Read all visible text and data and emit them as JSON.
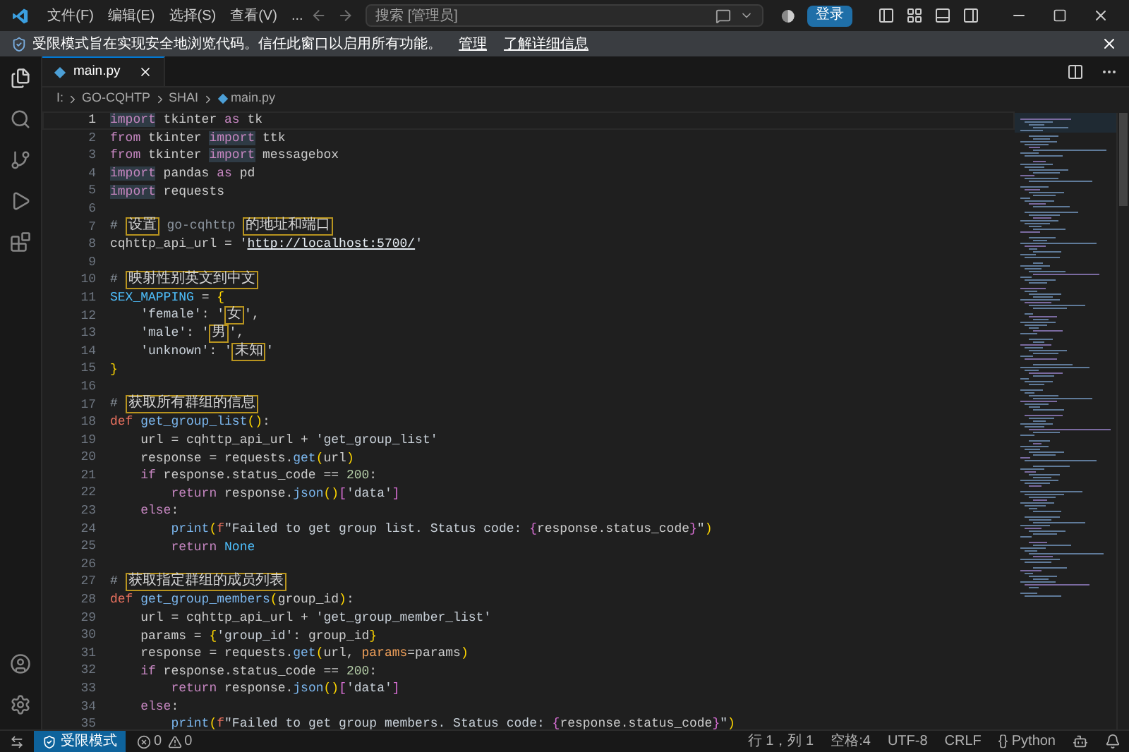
{
  "menu": [
    "文件(F)",
    "编辑(E)",
    "选择(S)",
    "查看(V)",
    "..."
  ],
  "search": {
    "placeholder": "搜索 [管理员]"
  },
  "login_button": "登录",
  "notice": {
    "text": "受限模式旨在实现安全地浏览代码。信任此窗口以启用所有功能。",
    "links": [
      "管理",
      "了解详细信息"
    ]
  },
  "tabs": [
    {
      "label": "main.py",
      "selected": true
    }
  ],
  "breadcrumb": [
    "I:",
    "GO-CQHTP",
    "SHAI",
    "main.py"
  ],
  "code": {
    "lines": [
      {
        "number": "1",
        "current": true,
        "tokens": [
          {
            "text": "import",
            "kind": "kw",
            "highlighted": true
          },
          {
            "text": " tkinter ",
            "kind": "plain"
          },
          {
            "text": "as",
            "kind": "kw"
          },
          {
            "text": " tk",
            "kind": "plain"
          }
        ]
      },
      {
        "number": "2",
        "current": false,
        "tokens": [
          {
            "text": "from",
            "kind": "kw"
          },
          {
            "text": " tkinter ",
            "kind": "plain"
          },
          {
            "text": "import",
            "kind": "kw",
            "highlighted": true
          },
          {
            "text": " ttk",
            "kind": "plain"
          }
        ]
      },
      {
        "number": "3",
        "current": false,
        "tokens": [
          {
            "text": "from",
            "kind": "kw"
          },
          {
            "text": " tkinter ",
            "kind": "plain"
          },
          {
            "text": "import",
            "kind": "kw",
            "highlighted": true
          },
          {
            "text": " messagebox",
            "kind": "plain"
          }
        ]
      },
      {
        "number": "4",
        "current": false,
        "tokens": [
          {
            "text": "import",
            "kind": "kw",
            "highlighted": true
          },
          {
            "text": " pandas ",
            "kind": "plain"
          },
          {
            "text": "as",
            "kind": "kw"
          },
          {
            "text": " pd",
            "kind": "plain"
          }
        ]
      },
      {
        "number": "5",
        "current": false,
        "tokens": [
          {
            "text": "import",
            "kind": "kw",
            "highlighted": true
          },
          {
            "text": " requests",
            "kind": "plain"
          }
        ]
      },
      {
        "number": "6",
        "current": false
      },
      {
        "number": "7",
        "current": false,
        "tokens": [
          {
            "text": "# ",
            "kind": "cm"
          },
          {
            "text": "设置",
            "kind": "flag"
          },
          {
            "text": " go-cqhttp ",
            "kind": "cm"
          },
          {
            "text": "的地址和端口",
            "kind": "flag"
          }
        ]
      },
      {
        "number": "8",
        "current": false,
        "tokens": [
          {
            "text": "cqhttp_api_url = ",
            "kind": "plain"
          },
          {
            "text": "'",
            "kind": "str"
          },
          {
            "text": "http://localhost:5700/",
            "kind": "url"
          },
          {
            "text": "'",
            "kind": "str"
          }
        ]
      },
      {
        "number": "9",
        "current": false
      },
      {
        "number": "10",
        "current": false,
        "tokens": [
          {
            "text": "# ",
            "kind": "cm"
          },
          {
            "text": "映射性别英文到中文",
            "kind": "flag"
          }
        ]
      },
      {
        "number": "11",
        "current": false,
        "tokens": [
          {
            "text": "SEX_MAPPING",
            "kind": "const"
          },
          {
            "text": " = ",
            "kind": "plain"
          },
          {
            "text": "{",
            "kind": "br"
          }
        ]
      },
      {
        "number": "12",
        "current": false,
        "tokens": [
          {
            "text": "    'female'",
            "kind": "str"
          },
          {
            "text": ": ",
            "kind": "plain"
          },
          {
            "text": "'",
            "kind": "str"
          },
          {
            "text": "女",
            "kind": "flag"
          },
          {
            "text": "'",
            "kind": "str"
          },
          {
            "text": ",",
            "kind": "plain"
          }
        ]
      },
      {
        "number": "13",
        "current": false,
        "tokens": [
          {
            "text": "    'male'",
            "kind": "str"
          },
          {
            "text": ": ",
            "kind": "plain"
          },
          {
            "text": "'",
            "kind": "str"
          },
          {
            "text": "男",
            "kind": "flag"
          },
          {
            "text": "'",
            "kind": "str"
          },
          {
            "text": ",",
            "kind": "plain"
          }
        ]
      },
      {
        "number": "14",
        "current": false,
        "tokens": [
          {
            "text": "    'unknown'",
            "kind": "str"
          },
          {
            "text": ": ",
            "kind": "plain"
          },
          {
            "text": "'",
            "kind": "str"
          },
          {
            "text": "未知",
            "kind": "flag"
          },
          {
            "text": "'",
            "kind": "str"
          }
        ]
      },
      {
        "number": "15",
        "current": false,
        "tokens": [
          {
            "text": "}",
            "kind": "br"
          }
        ]
      },
      {
        "number": "16",
        "current": false
      },
      {
        "number": "17",
        "current": false,
        "tokens": [
          {
            "text": "# ",
            "kind": "cm"
          },
          {
            "text": "获取所有群组的信息",
            "kind": "flag"
          }
        ]
      },
      {
        "number": "18",
        "current": false,
        "tokens": [
          {
            "text": "def",
            "kind": "def"
          },
          {
            "text": " get_group_list",
            "kind": "fn"
          },
          {
            "text": "()",
            "kind": "br"
          },
          {
            "text": ":",
            "kind": "plain"
          }
        ]
      },
      {
        "number": "19",
        "current": false,
        "tokens": [
          {
            "text": "    url = cqhttp_api_url + ",
            "kind": "plain"
          },
          {
            "text": "'get_group_list'",
            "kind": "str"
          }
        ]
      },
      {
        "number": "20",
        "current": false,
        "tokens": [
          {
            "text": "    response = requests.",
            "kind": "plain"
          },
          {
            "text": "get",
            "kind": "fn"
          },
          {
            "text": "(",
            "kind": "br"
          },
          {
            "text": "url",
            "kind": "plain"
          },
          {
            "text": ")",
            "kind": "br"
          }
        ]
      },
      {
        "number": "21",
        "current": false,
        "tokens": [
          {
            "text": "    if",
            "kind": "kw"
          },
          {
            "text": " response.status_code == ",
            "kind": "plain"
          },
          {
            "text": "200",
            "kind": "num"
          },
          {
            "text": ":",
            "kind": "plain"
          }
        ]
      },
      {
        "number": "22",
        "current": false,
        "tokens": [
          {
            "text": "        return",
            "kind": "kw"
          },
          {
            "text": " response.",
            "kind": "plain"
          },
          {
            "text": "json",
            "kind": "fn"
          },
          {
            "text": "()",
            "kind": "br"
          },
          {
            "text": "[",
            "kind": "br2"
          },
          {
            "text": "'data'",
            "kind": "str"
          },
          {
            "text": "]",
            "kind": "br2"
          }
        ]
      },
      {
        "number": "23",
        "current": false,
        "tokens": [
          {
            "text": "    else",
            "kind": "kw"
          },
          {
            "text": ":",
            "kind": "plain"
          }
        ]
      },
      {
        "number": "24",
        "current": false,
        "tokens": [
          {
            "text": "        print",
            "kind": "fn"
          },
          {
            "text": "(",
            "kind": "br"
          },
          {
            "text": "f",
            "kind": "def"
          },
          {
            "text": "\"Failed to get group list. Status code: ",
            "kind": "str"
          },
          {
            "text": "{",
            "kind": "br2"
          },
          {
            "text": "response.status_code",
            "kind": "plain"
          },
          {
            "text": "}",
            "kind": "br2"
          },
          {
            "text": "\"",
            "kind": "str"
          },
          {
            "text": ")",
            "kind": "br"
          }
        ]
      },
      {
        "number": "25",
        "current": false,
        "tokens": [
          {
            "text": "        return",
            "kind": "kw"
          },
          {
            "text": " None",
            "kind": "const"
          }
        ]
      },
      {
        "number": "26",
        "current": false
      },
      {
        "number": "27",
        "current": false,
        "tokens": [
          {
            "text": "# ",
            "kind": "cm"
          },
          {
            "text": "获取指定群组的成员列表",
            "kind": "flag"
          }
        ]
      },
      {
        "number": "28",
        "current": false,
        "tokens": [
          {
            "text": "def",
            "kind": "def"
          },
          {
            "text": " get_group_members",
            "kind": "fn"
          },
          {
            "text": "(",
            "kind": "br"
          },
          {
            "text": "group_id",
            "kind": "plain"
          },
          {
            "text": ")",
            "kind": "br"
          },
          {
            "text": ":",
            "kind": "plain"
          }
        ]
      },
      {
        "number": "29",
        "current": false,
        "tokens": [
          {
            "text": "    url = cqhttp_api_url + ",
            "kind": "plain"
          },
          {
            "text": "'get_group_member_list'",
            "kind": "str"
          }
        ]
      },
      {
        "number": "30",
        "current": false,
        "tokens": [
          {
            "text": "    params = ",
            "kind": "plain"
          },
          {
            "text": "{",
            "kind": "br"
          },
          {
            "text": "'group_id'",
            "kind": "str"
          },
          {
            "text": ": group_id",
            "kind": "plain"
          },
          {
            "text": "}",
            "kind": "br"
          }
        ]
      },
      {
        "number": "31",
        "current": false,
        "tokens": [
          {
            "text": "    response = requests.",
            "kind": "plain"
          },
          {
            "text": "get",
            "kind": "fn"
          },
          {
            "text": "(",
            "kind": "br"
          },
          {
            "text": "url, ",
            "kind": "plain"
          },
          {
            "text": "params",
            "kind": "param"
          },
          {
            "text": "=params",
            "kind": "plain"
          },
          {
            "text": ")",
            "kind": "br"
          }
        ]
      },
      {
        "number": "32",
        "current": false,
        "tokens": [
          {
            "text": "    if",
            "kind": "kw"
          },
          {
            "text": " response.status_code == ",
            "kind": "plain"
          },
          {
            "text": "200",
            "kind": "num"
          },
          {
            "text": ":",
            "kind": "plain"
          }
        ]
      },
      {
        "number": "33",
        "current": false,
        "tokens": [
          {
            "text": "        return",
            "kind": "kw"
          },
          {
            "text": " response.",
            "kind": "plain"
          },
          {
            "text": "json",
            "kind": "fn"
          },
          {
            "text": "()",
            "kind": "br"
          },
          {
            "text": "[",
            "kind": "br2"
          },
          {
            "text": "'data'",
            "kind": "str"
          },
          {
            "text": "]",
            "kind": "br2"
          }
        ]
      },
      {
        "number": "34",
        "current": false,
        "tokens": [
          {
            "text": "    else",
            "kind": "kw"
          },
          {
            "text": ":",
            "kind": "plain"
          }
        ]
      },
      {
        "number": "35",
        "current": false,
        "tokens": [
          {
            "text": "        print",
            "kind": "fn"
          },
          {
            "text": "(",
            "kind": "br"
          },
          {
            "text": "f",
            "kind": "def"
          },
          {
            "text": "\"Failed to get group members. Status code: ",
            "kind": "str"
          },
          {
            "text": "{",
            "kind": "br2"
          },
          {
            "text": "response.status_code",
            "kind": "plain"
          },
          {
            "text": "}",
            "kind": "br2"
          },
          {
            "text": "\"",
            "kind": "str"
          },
          {
            "text": ")",
            "kind": "br"
          }
        ]
      }
    ]
  },
  "status_bar": {
    "mode": "受限模式",
    "errors": "0",
    "warnings": "0",
    "items": [
      "行 1，列 1",
      "空格:4",
      "UTF-8",
      "CRLF",
      "{} Python"
    ]
  }
}
